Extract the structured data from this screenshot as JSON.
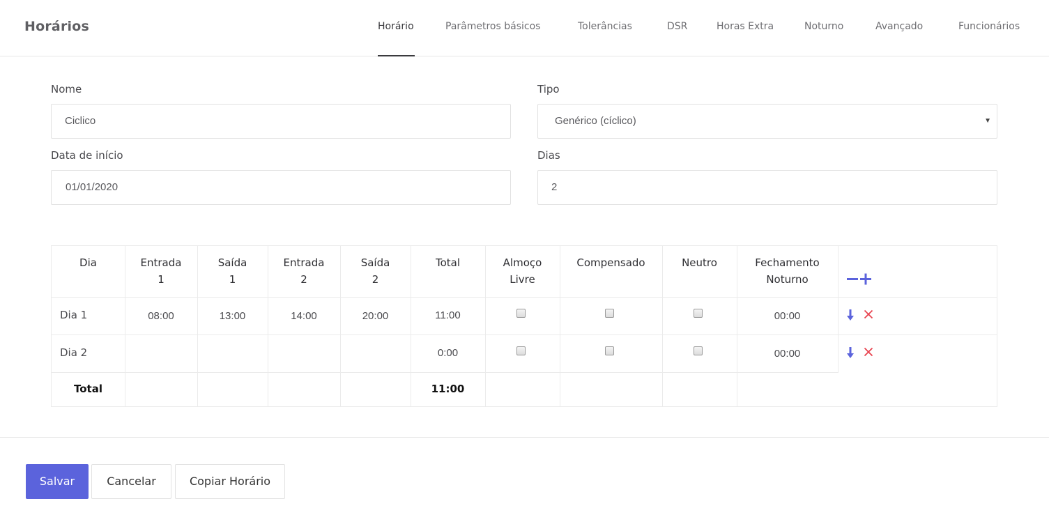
{
  "app": {
    "title": "Horários"
  },
  "nav": {
    "tabs": [
      {
        "label": "Horário",
        "active": true
      },
      {
        "label": "Parâmetros básicos"
      },
      {
        "label": "Tolerâncias"
      },
      {
        "label": "DSR"
      },
      {
        "label": "Horas Extra"
      },
      {
        "label": "Noturno"
      },
      {
        "label": "Avançado"
      },
      {
        "label": "Funcionários"
      }
    ]
  },
  "form": {
    "nome": {
      "label": "Nome",
      "value": "Ciclico"
    },
    "tipo": {
      "label": "Tipo",
      "value": "Genérico (cíclico)"
    },
    "data_inicio": {
      "label": "Data de início",
      "value": "01/01/2020"
    },
    "dias": {
      "label": "Dias",
      "value": "2"
    }
  },
  "table": {
    "headers": {
      "dia": "Dia",
      "entrada1_a": "Entrada",
      "entrada1_b": "1",
      "saida1_a": "Saída",
      "saida1_b": "1",
      "entrada2_a": "Entrada",
      "entrada2_b": "2",
      "saida2_a": "Saída",
      "saida2_b": "2",
      "total": "Total",
      "almoco_a": "Almoço",
      "almoco_b": "Livre",
      "compensado": "Compensado",
      "neutro": "Neutro",
      "fech_a": "Fechamento",
      "fech_b": "Noturno"
    },
    "rows": [
      {
        "dia": "Dia 1",
        "entrada1": "08:00",
        "saida1": "13:00",
        "entrada2": "14:00",
        "saida2": "20:00",
        "total": "11:00",
        "almoco_livre": false,
        "compensado": false,
        "neutro": false,
        "fechamento_noturno": "00:00"
      },
      {
        "dia": "Dia 2",
        "entrada1": "",
        "saida1": "",
        "entrada2": "",
        "saida2": "",
        "total": "0:00",
        "almoco_livre": false,
        "compensado": false,
        "neutro": false,
        "fechamento_noturno": "00:00"
      }
    ],
    "footer": {
      "label": "Total",
      "total": "11:00"
    }
  },
  "actions": {
    "save": "Salvar",
    "cancel": "Cancelar",
    "copy": "Copiar Horário"
  },
  "colors": {
    "accent": "#5b63dc",
    "remove": "#e8434f"
  }
}
